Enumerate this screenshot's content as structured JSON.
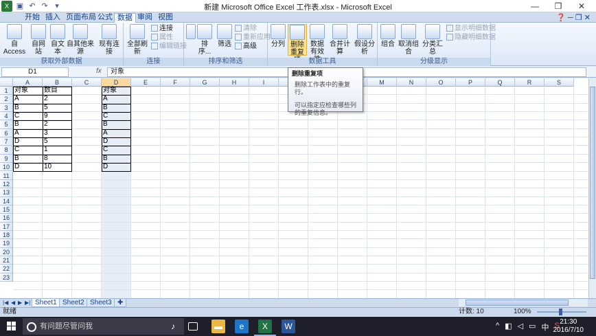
{
  "window": {
    "title": "新建 Microsoft Office Excel 工作表.xlsx - Microsoft Excel"
  },
  "menu_tabs": [
    "开始",
    "插入",
    "页面布局",
    "公式",
    "数据",
    "审阅",
    "视图"
  ],
  "active_tab": "数据",
  "ribbon": {
    "external": {
      "label": "获取外部数据",
      "access": "自 Access",
      "web": "自网站",
      "text": "自文本",
      "other": "自其他来源",
      "existing": "现有连接"
    },
    "connections": {
      "label": "连接",
      "refresh": "全部刷新",
      "conn": "连接",
      "props": "属性",
      "edit_links": "编辑链接"
    },
    "sort_filter": {
      "label": "排序和筛选",
      "sort": "排序...",
      "filter": "筛选",
      "clear": "清除",
      "reapply": "重新应用",
      "advanced": "高级"
    },
    "data_tools": {
      "label": "数据工具",
      "text_to_col": "分列",
      "remove_dup_1": "删除",
      "remove_dup_2": "重复项",
      "validation_1": "数据",
      "validation_2": "有效性",
      "consolidate": "合并计算",
      "whatif": "假设分析"
    },
    "outline": {
      "label": "分级显示",
      "group": "组合",
      "ungroup": "取消组合",
      "subtotal": "分类汇总",
      "show_detail": "显示明细数据",
      "hide_detail": "隐藏明细数据"
    }
  },
  "formula_bar": {
    "name_box": "D1",
    "fx": "fx",
    "content": "对象"
  },
  "tooltip": {
    "title": "删除重复项",
    "line1": "删除工作表中的重复行。",
    "line2": "可以指定应检查哪些列的重复信息。"
  },
  "columns": [
    "A",
    "B",
    "C",
    "D",
    "E",
    "F",
    "G",
    "H",
    "I",
    "J",
    "K",
    "L",
    "M",
    "N",
    "O",
    "P",
    "Q",
    "R",
    "S"
  ],
  "rows": [
    "1",
    "2",
    "3",
    "4",
    "5",
    "6",
    "7",
    "8",
    "9",
    "10",
    "11",
    "12",
    "13",
    "14",
    "15",
    "16",
    "17",
    "18",
    "19",
    "20",
    "21",
    "22",
    "23"
  ],
  "table": {
    "headers": [
      "对象",
      "数目"
    ],
    "data": [
      [
        "A",
        "2"
      ],
      [
        "B",
        "5"
      ],
      [
        "C",
        "9"
      ],
      [
        "B",
        "2"
      ],
      [
        "A",
        "3"
      ],
      [
        "D",
        "5"
      ],
      [
        "C",
        "1"
      ],
      [
        "B",
        "8"
      ],
      [
        "D",
        "10"
      ]
    ]
  },
  "col_d": [
    "对象",
    "A",
    "B",
    "C",
    "B",
    "A",
    "D",
    "C",
    "B",
    "D"
  ],
  "sheets": [
    "Sheet1",
    "Sheet2",
    "Sheet3"
  ],
  "active_sheet": "Sheet1",
  "status": {
    "ready": "就绪",
    "count": "计数: 10",
    "zoom": "100%"
  },
  "taskbar": {
    "search_placeholder": "有问题尽管问我",
    "time": "21:30",
    "date": "2016/7/10",
    "ime": "中"
  }
}
